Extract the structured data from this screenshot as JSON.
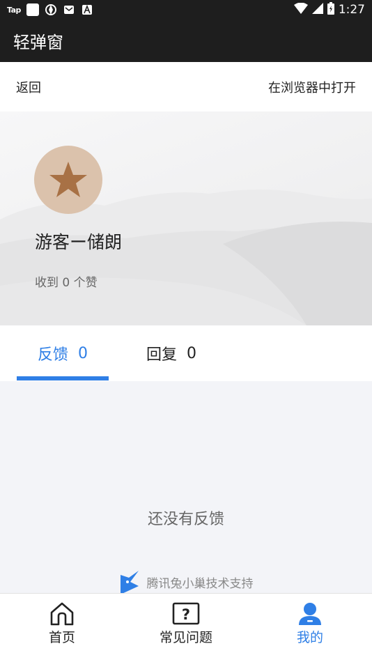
{
  "status_bar": {
    "app_label": "Tap",
    "time": "1:27"
  },
  "app_bar": {
    "title": "轻弹窗"
  },
  "nav": {
    "back": "返回",
    "open_in_browser": "在浏览器中打开"
  },
  "profile": {
    "avatar_icon": "star-icon",
    "username": "游客ー储朗",
    "likes": "收到 0 个赞"
  },
  "tabs": [
    {
      "label": "反馈",
      "count": "0",
      "active": true
    },
    {
      "label": "回复",
      "count": "0",
      "active": false
    }
  ],
  "content": {
    "empty_text": "还没有反馈",
    "support_text": "腾讯兔小巢技术支持"
  },
  "bottom_nav": [
    {
      "label": "首页",
      "icon": "home-icon",
      "active": false
    },
    {
      "label": "常见问题",
      "icon": "question-icon",
      "active": false
    },
    {
      "label": "我的",
      "icon": "user-icon",
      "active": true
    }
  ],
  "colors": {
    "accent": "#2f7fe6",
    "topbar": "#1e1e1e",
    "avatar_bg": "#dbc2ac",
    "star": "#a87145",
    "content_bg": "#f3f4f8"
  }
}
